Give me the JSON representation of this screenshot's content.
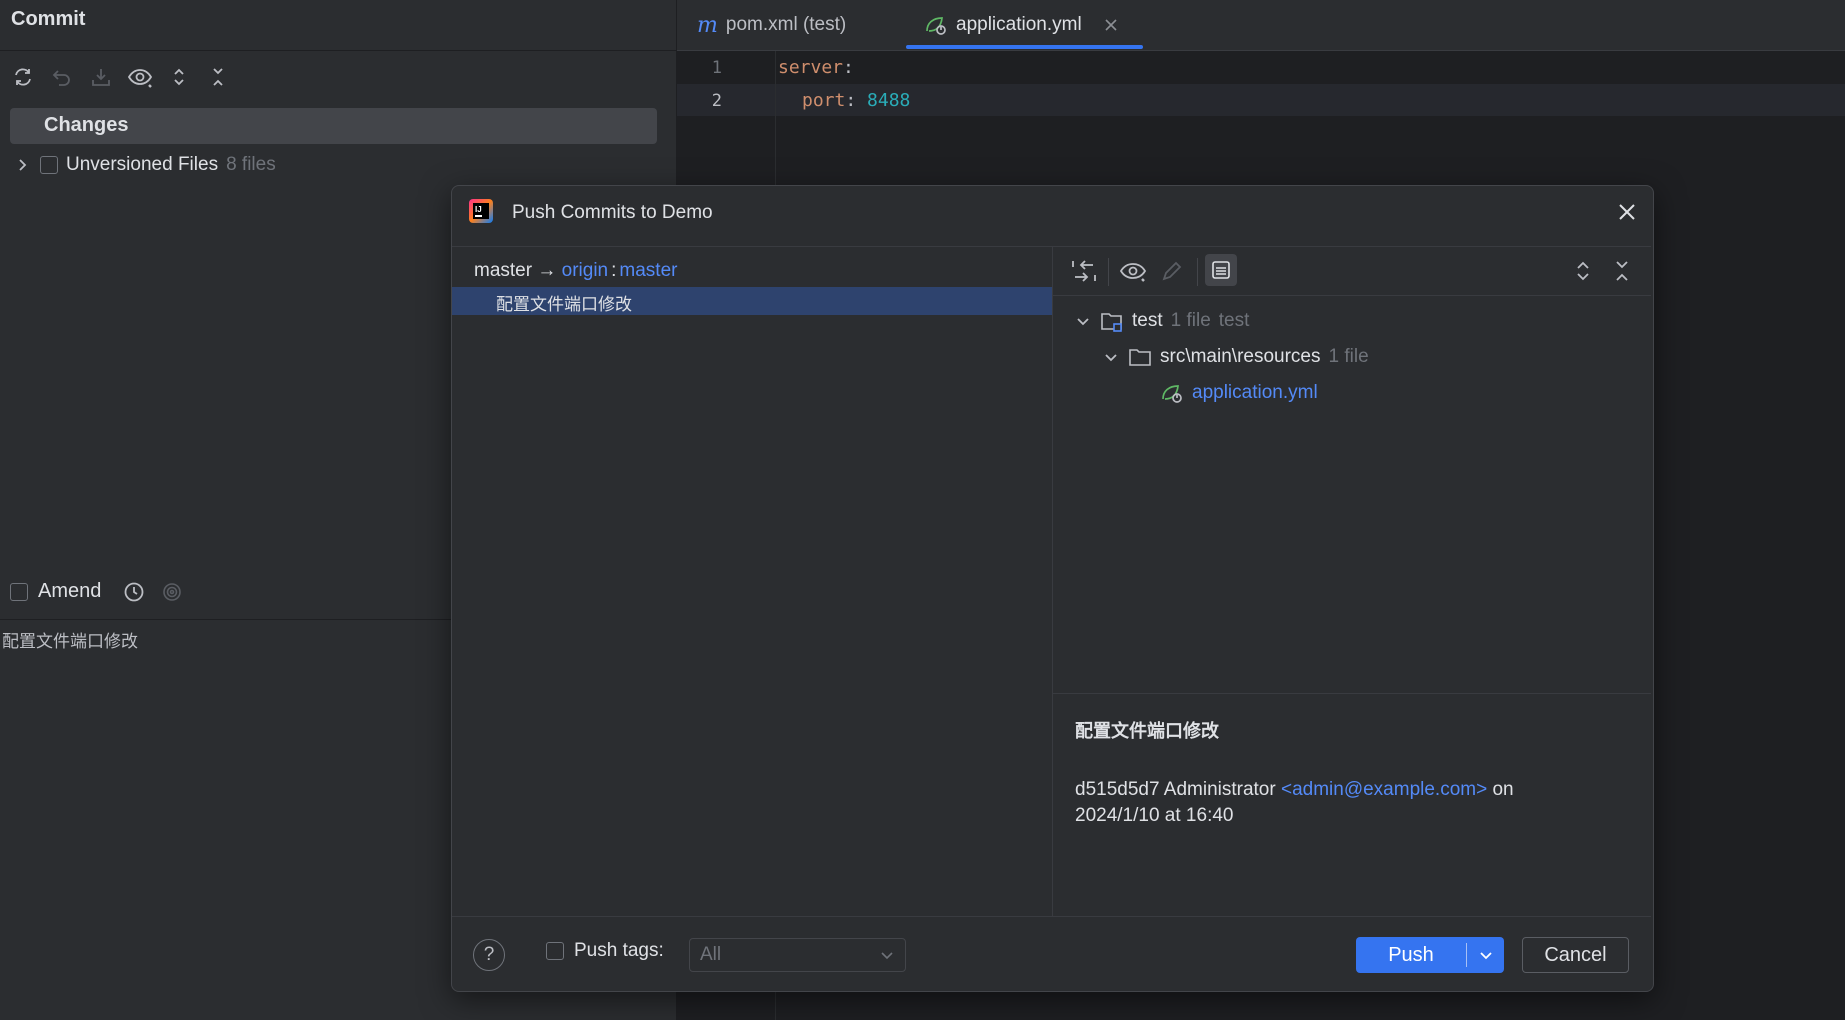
{
  "left_panel": {
    "title": "Commit",
    "changes_label": "Changes",
    "unversioned_label": "Unversioned Files",
    "unversioned_count": "8 files",
    "amend_label": "Amend",
    "commit_message": "配置文件端口修改"
  },
  "editor": {
    "tabs": [
      {
        "label": "pom.xml (test)",
        "icon": "maven-m-icon"
      },
      {
        "label": "application.yml",
        "icon": "spring-leaf-icon"
      }
    ],
    "lines": [
      {
        "num": "1",
        "key": "server",
        "sep": ":"
      },
      {
        "num": "2",
        "key": "port",
        "sep": ":",
        "value": "8488"
      }
    ]
  },
  "dialog": {
    "title": "Push Commits to Demo",
    "branch": {
      "local": "master",
      "arrow": "→",
      "remote": "origin",
      "colon": ":",
      "remote_branch": "master"
    },
    "commit_subject": "配置文件端口修改",
    "tree": {
      "root": {
        "name": "test",
        "count": "1 file",
        "module": "test"
      },
      "folder": {
        "name": "src\\main\\resources",
        "count": "1 file"
      },
      "file": {
        "name": "application.yml"
      }
    },
    "details": {
      "subject": "配置文件端口修改",
      "hash": "d515d5d7",
      "author": "Administrator",
      "email": "<admin@example.com>",
      "on": "on",
      "date": "2024/1/10 at 16:40"
    },
    "footer": {
      "help": "?",
      "push_tags_label": "Push tags:",
      "tags_value": "All",
      "push_label": "Push",
      "cancel_label": "Cancel"
    }
  },
  "colors": {
    "accent": "#3574f0",
    "link": "#548af7",
    "yaml_key": "#cf8e6d",
    "yaml_number": "#2aacb8",
    "selection": "#2e436e"
  }
}
